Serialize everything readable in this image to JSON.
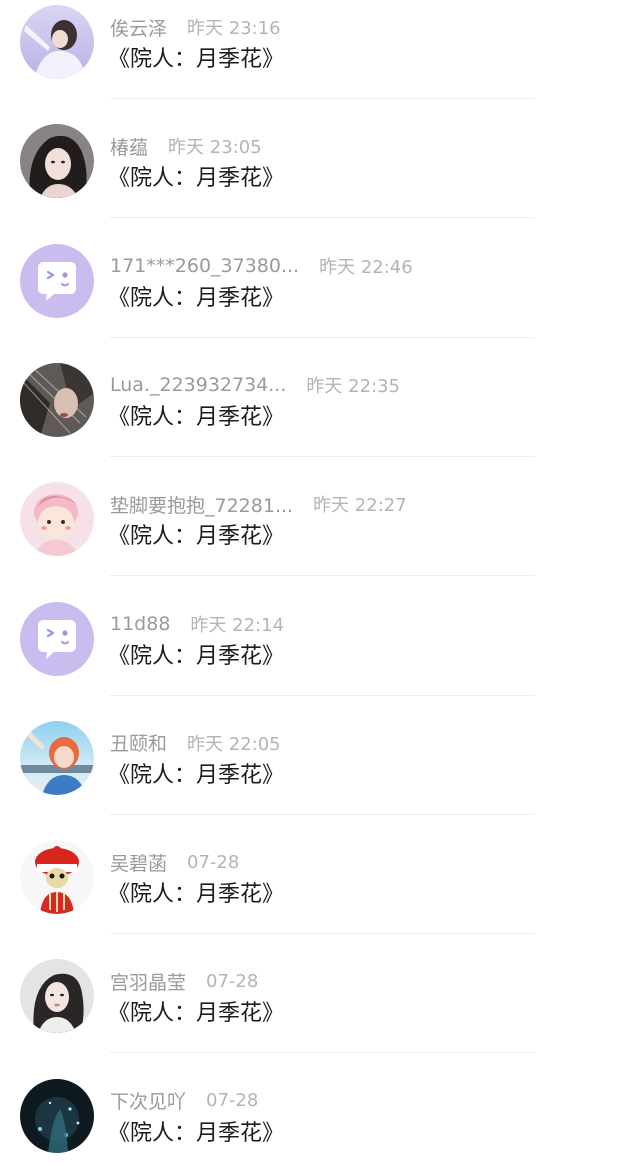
{
  "comments": [
    {
      "name": "俟云泽",
      "time": "昨天 23:16",
      "message": "《院人：月季花》",
      "avatar": "photo-avatar"
    },
    {
      "name": "椿蕴",
      "time": "昨天 23:05",
      "message": "《院人：月季花》",
      "avatar": "photo-avatar"
    },
    {
      "name": "171***260_37380...",
      "time": "昨天 22:46",
      "message": "《院人：月季花》",
      "avatar": "default-chat-avatar"
    },
    {
      "name": "Lua._223932734...",
      "time": "昨天 22:35",
      "message": "《院人：月季花》",
      "avatar": "photo-avatar"
    },
    {
      "name": "垫脚要抱抱_72281...",
      "time": "昨天 22:27",
      "message": "《院人：月季花》",
      "avatar": "cartoon-avatar"
    },
    {
      "name": "11d88",
      "time": "昨天 22:14",
      "message": "《院人：月季花》",
      "avatar": "default-chat-avatar"
    },
    {
      "name": "丑颐和",
      "time": "昨天 22:05",
      "message": "《院人：月季花》",
      "avatar": "photo-avatar"
    },
    {
      "name": "吴碧菡",
      "time": "07-28",
      "message": "《院人：月季花》",
      "avatar": "cartoon-avatar"
    },
    {
      "name": "宫羽晶莹",
      "time": "07-28",
      "message": "《院人：月季花》",
      "avatar": "photo-avatar"
    },
    {
      "name": "下次见吖",
      "time": "07-28",
      "message": "《院人：月季花》",
      "avatar": "photo-avatar"
    }
  ],
  "colors": {
    "name": "#9a9a9a",
    "time": "#b4b4b4",
    "message": "#1c1c1c",
    "default_avatar_bg": "#cbbcf0",
    "divider": "#ededed"
  }
}
